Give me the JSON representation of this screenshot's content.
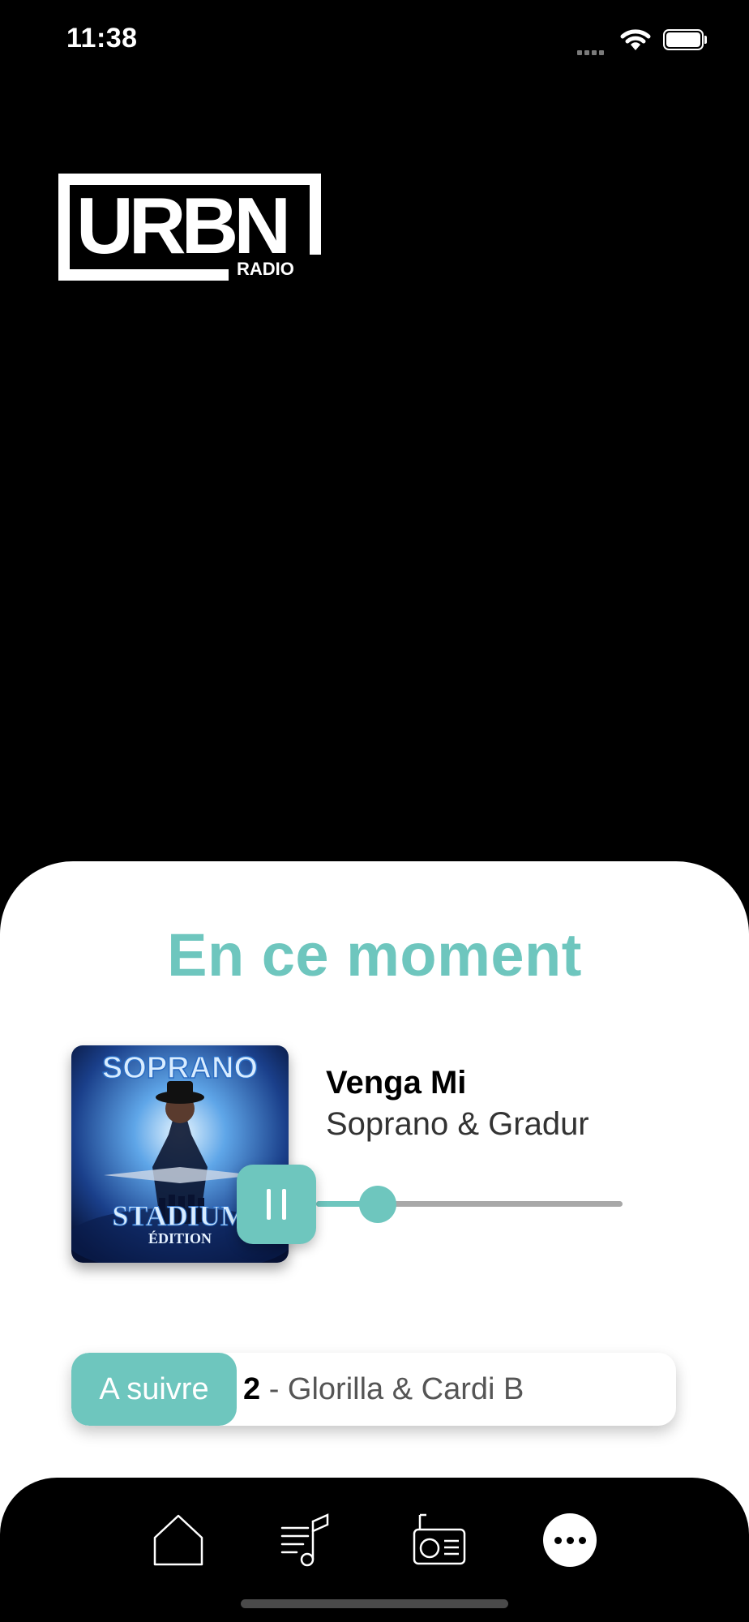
{
  "status_bar": {
    "time": "11:38"
  },
  "logo": {
    "text": "URBN",
    "subtext": "RADIO"
  },
  "now_playing": {
    "section_title": "En ce moment",
    "track_title": "Venga Mi",
    "artist": "Soprano & Gradur",
    "progress": 0.2,
    "album_art": {
      "top_text": "SOPRANO",
      "bottom_text": "STADIUM",
      "sub_text": "ÉDITION"
    }
  },
  "up_next": {
    "label": "A suivre",
    "lead": "2",
    "text": " - Glorilla & Cardi B"
  },
  "tabbar": {
    "items": [
      "home-icon",
      "music-list-icon",
      "radio-icon",
      "more-icon"
    ]
  },
  "colors": {
    "accent": "#6ec6be",
    "background": "#000000",
    "sheet": "#ffffff"
  }
}
